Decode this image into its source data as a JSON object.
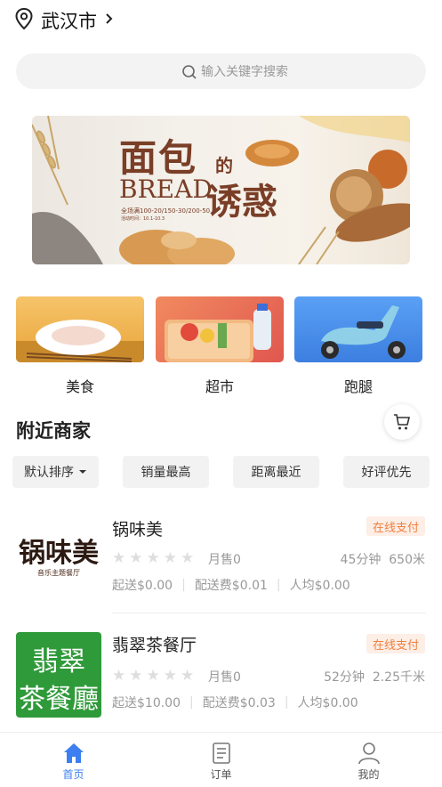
{
  "header": {
    "city": "武汉市"
  },
  "search": {
    "placeholder": "输入关键字搜索"
  },
  "banner": {
    "title_cn": "面包的诱惑",
    "title_part1": "面包",
    "title_de": "的",
    "title_part2": "诱惑",
    "title_en": "BREAD",
    "promo": "全场满100-20/150-30/200-50",
    "date": "活动时间：10.1-10.3"
  },
  "categories": [
    {
      "label": "美食"
    },
    {
      "label": "超市"
    },
    {
      "label": "跑腿"
    }
  ],
  "nearby": {
    "title": "附近商家"
  },
  "filters": {
    "default": "默认排序",
    "sales": "销量最高",
    "distance": "距离最近",
    "rating": "好评优先"
  },
  "stores": [
    {
      "name": "锅味美",
      "logo_text": "锅味美",
      "logo_sub": "音乐主题餐厅",
      "badge": "在线支付",
      "sold": "月售0",
      "eta": "45分钟",
      "distance": "650米",
      "min_order": "起送$0.00",
      "delivery_fee": "配送费$0.01",
      "per_person": "人均$0.00"
    },
    {
      "name": "翡翠茶餐厅",
      "logo_text_1": "翡翠",
      "logo_text_2": "茶餐廳",
      "badge": "在线支付",
      "sold": "月售0",
      "eta": "52分钟",
      "distance": "2.25千米",
      "min_order": "起送$10.00",
      "delivery_fee": "配送费$0.03",
      "per_person": "人均$0.00"
    }
  ],
  "tabbar": {
    "home": "首页",
    "orders": "订单",
    "mine": "我的"
  },
  "colors": {
    "accent": "#3d7ff0",
    "badge_text": "#f08040",
    "badge_bg": "#fdeee6",
    "green_logo": "#2f9a3a"
  },
  "icons": [
    "location-pin-icon",
    "chevron-right-icon",
    "search-icon",
    "cart-icon",
    "dropdown-caret-icon",
    "home-icon",
    "orders-icon",
    "profile-icon"
  ]
}
